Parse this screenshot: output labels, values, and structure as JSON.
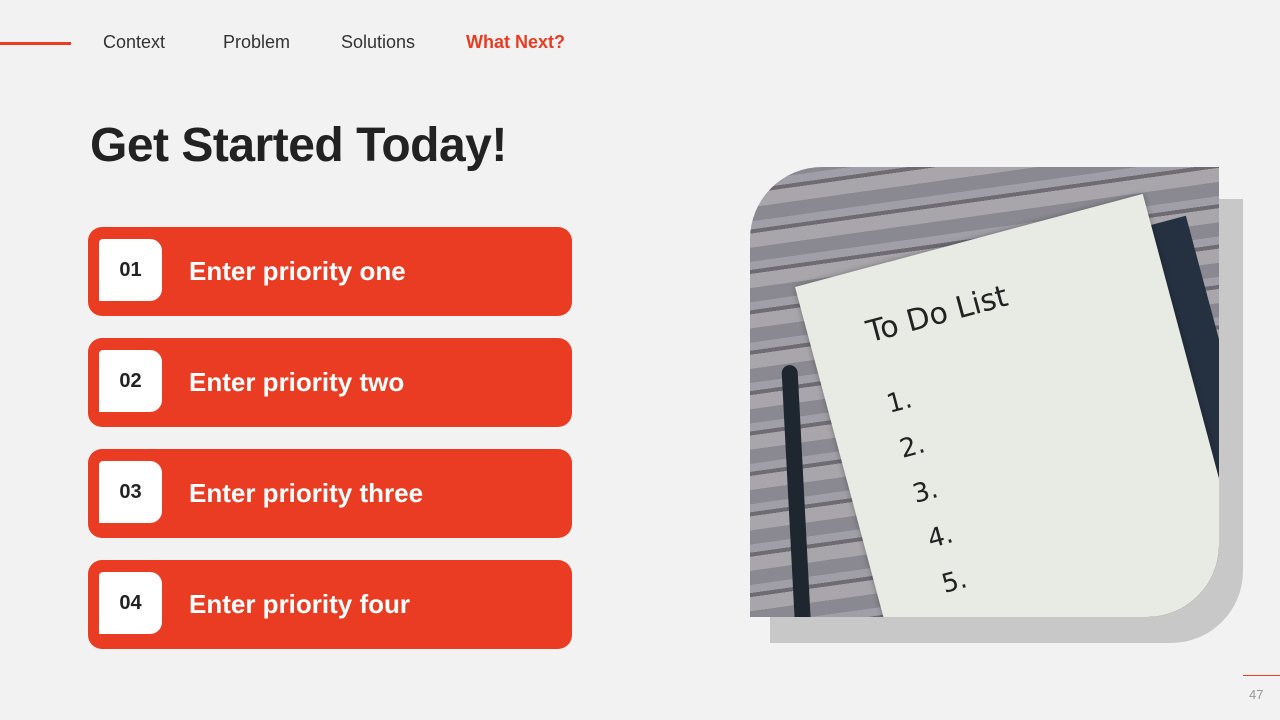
{
  "nav": {
    "items": [
      "Context",
      "Problem",
      "Solutions",
      "What Next?"
    ],
    "active": "What Next?"
  },
  "title": "Get Started Today!",
  "priorities": [
    {
      "num": "01",
      "label": "Enter priority one"
    },
    {
      "num": "02",
      "label": "Enter priority two"
    },
    {
      "num": "03",
      "label": "Enter priority three"
    },
    {
      "num": "04",
      "label": "Enter priority four"
    }
  ],
  "photo": {
    "heading": "To Do List",
    "lines": [
      "1.",
      "2.",
      "3.",
      "4.",
      "5."
    ]
  },
  "page_number": "47",
  "colors": {
    "accent": "#ea3c23",
    "background": "#f2f2f2"
  }
}
